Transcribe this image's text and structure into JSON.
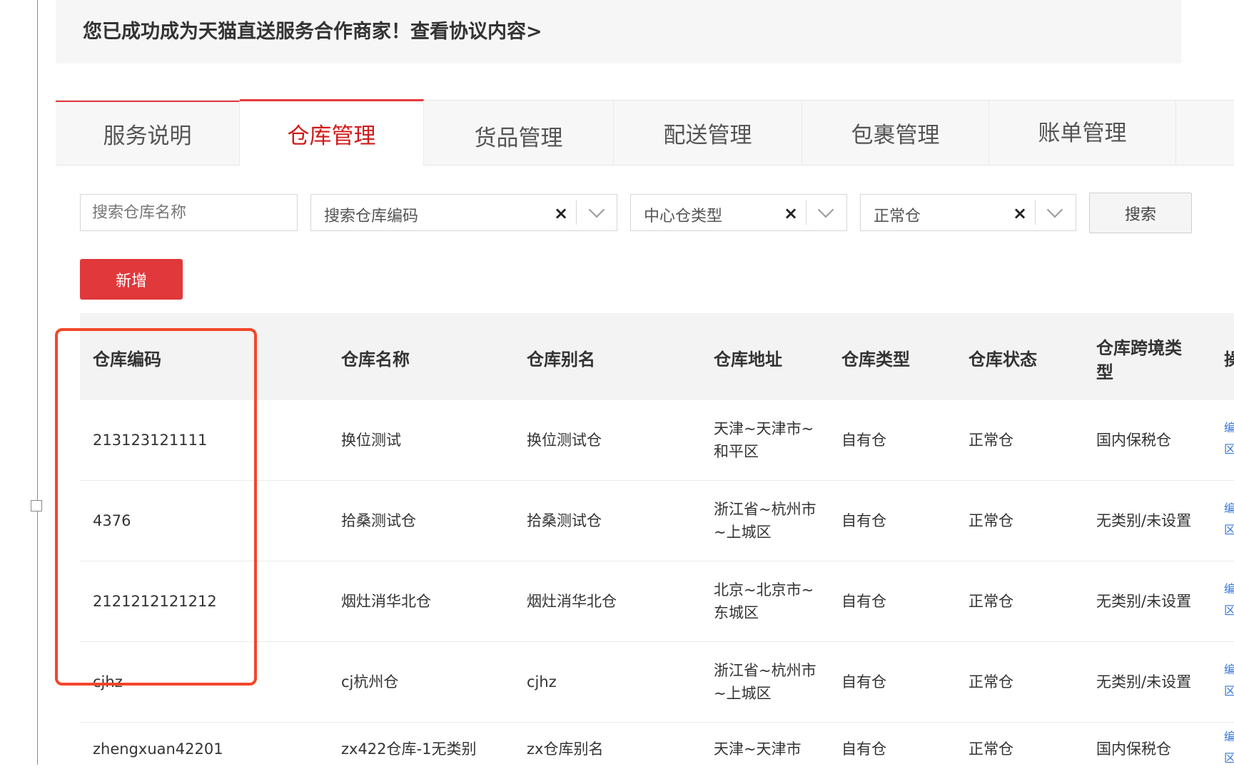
{
  "banner": {
    "text": "您已成功成为天猫直送服务合作商家！查看协议内容>"
  },
  "tabs": [
    {
      "label": "服务说明"
    },
    {
      "label": "仓库管理"
    },
    {
      "label": "货品管理"
    },
    {
      "label": "配送管理"
    },
    {
      "label": "包裹管理"
    },
    {
      "label": "账单管理"
    }
  ],
  "filters": {
    "name_placeholder": "搜索仓库名称",
    "code_value": "搜索仓库编码",
    "type_value": "中心仓类型",
    "status_value": "正常仓",
    "clear_symbol": "×"
  },
  "buttons": {
    "search": "搜索",
    "add": "新增"
  },
  "table": {
    "headers": {
      "code": "仓库编码",
      "name": "仓库名称",
      "alias": "仓库别名",
      "address": "仓库地址",
      "type": "仓库类型",
      "status": "仓库状态",
      "cross_line1": "仓库跨境类",
      "cross_line2": "型",
      "op": "操"
    },
    "rows": [
      {
        "code": "213123121111",
        "name": "换位测试",
        "alias": "换位测试仓",
        "address": "天津~天津市~\n和平区",
        "type": "自有仓",
        "status": "正常仓",
        "cross": "国内保税仓",
        "op": "编\n区"
      },
      {
        "code": "4376",
        "name": "拾桑测试仓",
        "alias": "拾桑测试仓",
        "address": "浙江省~杭州市\n~上城区",
        "type": "自有仓",
        "status": "正常仓",
        "cross": "无类别/未设置",
        "op": "编\n区"
      },
      {
        "code": "2121212121212",
        "name": "烟灶消华北仓",
        "alias": "烟灶消华北仓",
        "address": "北京~北京市~\n东城区",
        "type": "自有仓",
        "status": "正常仓",
        "cross": "无类别/未设置",
        "op": "编\n区"
      },
      {
        "code": "cjhz",
        "name": "cj杭州仓",
        "alias": "cjhz",
        "address": "浙江省~杭州市\n~上城区",
        "type": "自有仓",
        "status": "正常仓",
        "cross": "无类别/未设置",
        "op": "编\n区"
      },
      {
        "code": "zhengxuan42201",
        "name": "zx422仓库-1无类别",
        "alias": "zx仓库别名",
        "address": "天津~天津市",
        "type": "自有仓",
        "status": "正常仓",
        "cross": "国内保税仓",
        "op": "编\n区"
      }
    ]
  },
  "colors": {
    "accent": "#e4393c",
    "highlight": "#f4462a",
    "link": "#3377dd"
  }
}
